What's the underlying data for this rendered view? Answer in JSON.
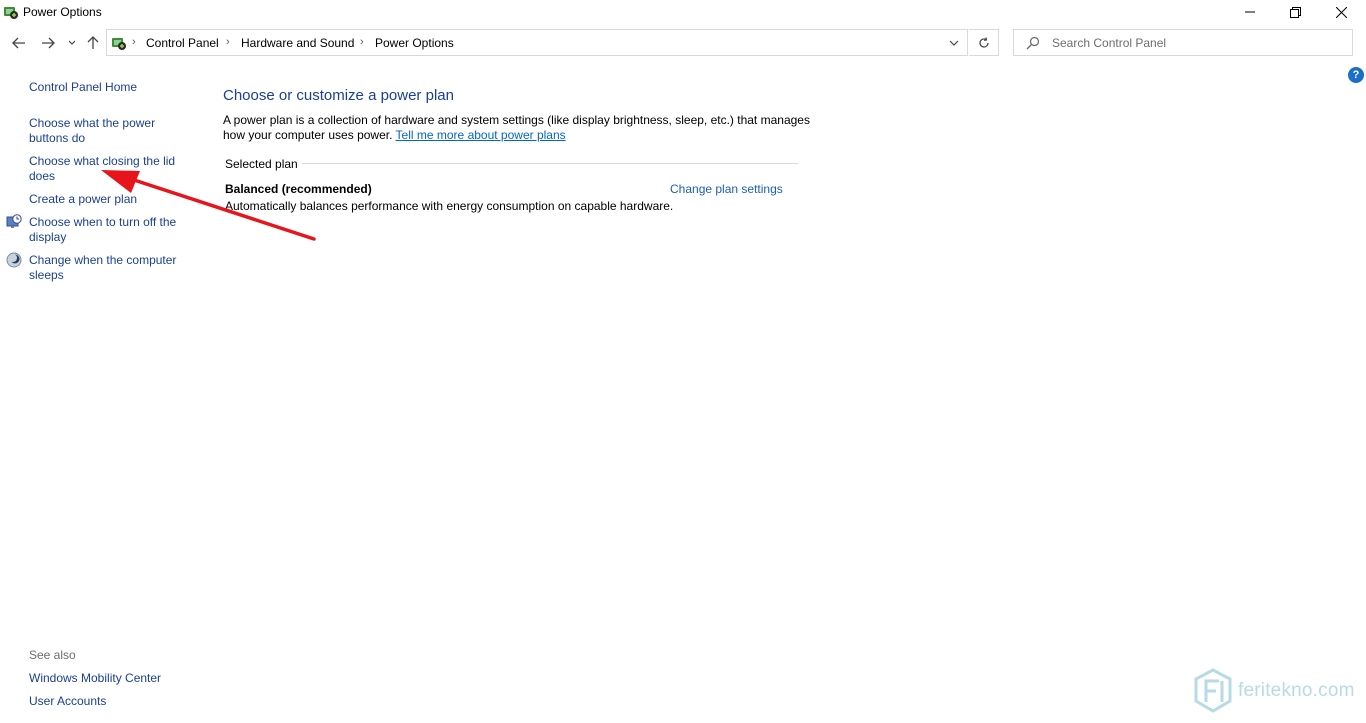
{
  "window": {
    "title": "Power Options",
    "icon": "power-options-icon"
  },
  "address": {
    "crumbs": [
      "Control Panel",
      "Hardware and Sound",
      "Power Options"
    ]
  },
  "search": {
    "placeholder": "Search Control Panel"
  },
  "sidebar": {
    "items": [
      {
        "label": "Control Panel Home"
      },
      {
        "label": "Choose what the power buttons do"
      },
      {
        "label": "Choose what closing the lid does"
      },
      {
        "label": "Create a power plan"
      },
      {
        "label": "Choose when to turn off the display",
        "icon": "display-clock-icon"
      },
      {
        "label": "Change when the computer sleeps",
        "icon": "sleep-moon-icon"
      }
    ],
    "see_also_label": "See also",
    "see_also": [
      {
        "label": "Windows Mobility Center"
      },
      {
        "label": "User Accounts"
      }
    ]
  },
  "main": {
    "title": "Choose or customize a power plan",
    "description": "A power plan is a collection of hardware and system settings (like display brightness, sleep, etc.) that manages how your computer uses power.",
    "tell_more": "Tell me more about power plans",
    "selected_label": "Selected plan",
    "plan": {
      "name": "Balanced (recommended)",
      "description": "Automatically balances performance with energy consumption on capable hardware.",
      "change_link": "Change plan settings"
    }
  },
  "watermark": {
    "text": "feritekno.com"
  },
  "colors": {
    "link": "#1a3f93",
    "title_blue": "#1a3f93",
    "annotation_arrow": "#e8141b",
    "help_blue": "#1a6fc9"
  }
}
